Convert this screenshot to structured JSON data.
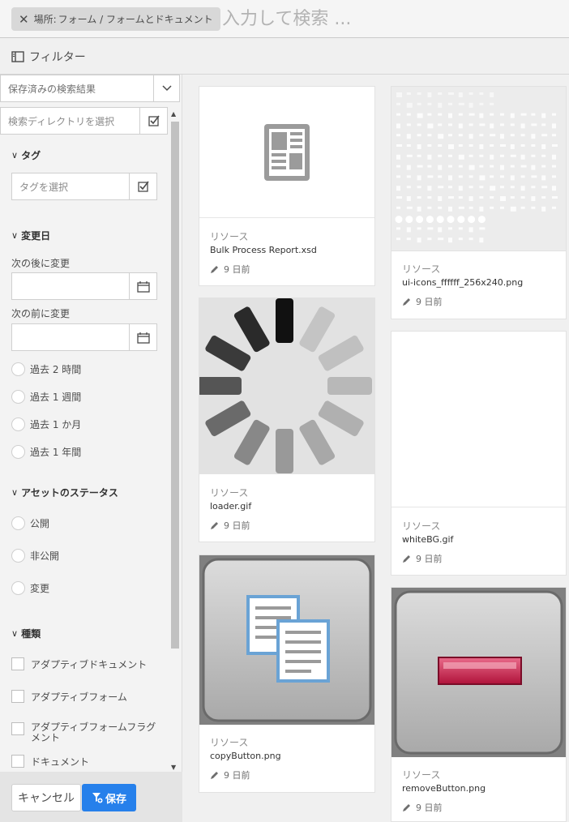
{
  "search": {
    "location_prefix": "場所:",
    "location_path": "フォーム / フォームとドキュメント",
    "placeholder": "入力して検索 ..."
  },
  "filter": {
    "title": "フィルター",
    "saved_search": "保存済みの検索結果",
    "directory_placeholder": "検索ディレクトリを選択",
    "tags": {
      "heading": "タグ",
      "placeholder": "タグを選択"
    },
    "modified": {
      "heading": "変更日",
      "after_label": "次の後に変更",
      "before_label": "次の前に変更",
      "options": [
        "過去 2 時間",
        "過去 1 週間",
        "過去 1 か月",
        "過去 1 年間"
      ]
    },
    "asset_status": {
      "heading": "アセットのステータス",
      "options": [
        "公開",
        "非公開",
        "変更"
      ]
    },
    "type": {
      "heading": "種類",
      "options": [
        "アダプティブドキュメント",
        "アダプティブフォーム",
        "アダプティブフォームフラグメント",
        "ドキュメント"
      ]
    },
    "cancel_label": "キャンセル",
    "save_label": "保存"
  },
  "cards": [
    {
      "type": "リソース",
      "name": "Bulk Process Report.xsd",
      "time": "9 日前",
      "icon": "document-icon"
    },
    {
      "type": "リソース",
      "name": "ui-icons_ffffff_256x240.png",
      "time": "9 日前",
      "icon": "icon-sprite-thumbnail"
    },
    {
      "type": "リソース",
      "name": "loader.gif",
      "time": "9 日前",
      "icon": "loader-spinner-thumbnail"
    },
    {
      "type": "リソース",
      "name": "whiteBG.gif",
      "time": "9 日前",
      "icon": "blank-thumbnail"
    },
    {
      "type": "リソース",
      "name": "copyButton.png",
      "time": "9 日前",
      "icon": "copy-button-thumbnail"
    },
    {
      "type": "リソース",
      "name": "removeButton.png",
      "time": "9 日前",
      "icon": "remove-button-thumbnail"
    }
  ],
  "colors": {
    "accent": "#2680eb",
    "remove_red": "#c8163f"
  }
}
